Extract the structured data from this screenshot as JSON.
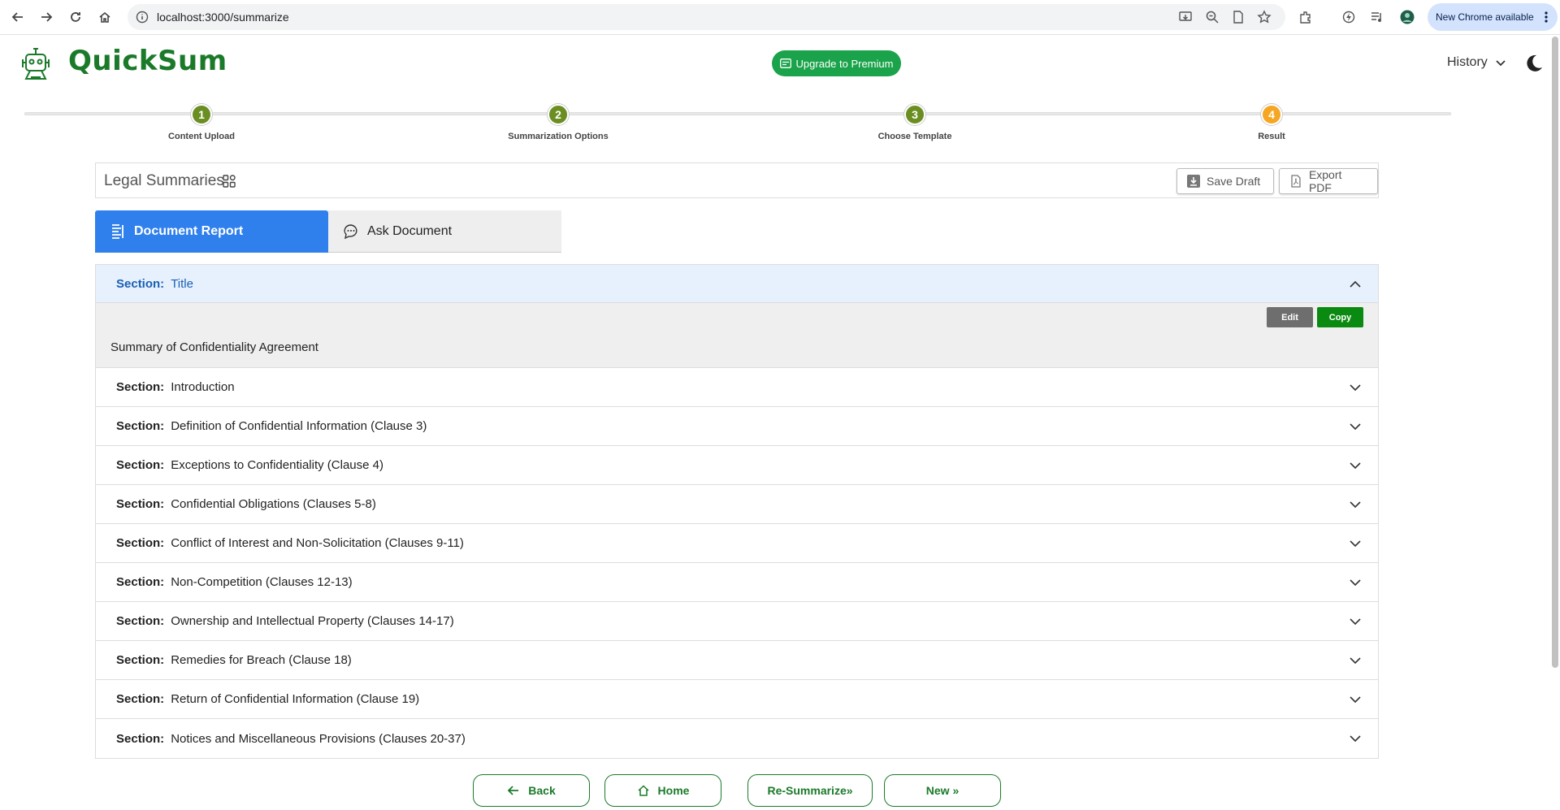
{
  "browser": {
    "url": "localhost:3000/summarize",
    "update_label": "New Chrome available"
  },
  "app": {
    "name": "QuickSum",
    "upgrade_label": "Upgrade to Premium",
    "history_label": "History",
    "brand_color": "#1b7a2a"
  },
  "stepper": {
    "steps": [
      {
        "number": "1",
        "label": "Content Upload",
        "color": "#6b8e23"
      },
      {
        "number": "2",
        "label": "Summarization Options",
        "color": "#6b8e23"
      },
      {
        "number": "3",
        "label": "Choose Template",
        "color": "#6b8e23"
      },
      {
        "number": "4",
        "label": "Result",
        "color": "#f5a623"
      }
    ]
  },
  "toolbar": {
    "title": "Legal Summaries",
    "save_draft_label": "Save Draft",
    "export_pdf_label": "Export PDF"
  },
  "tabs": {
    "active_label": "Document Report",
    "inactive_label": "Ask Document"
  },
  "sections": {
    "prefix": "Section:",
    "open": {
      "title": "Title",
      "content": "Summary of Confidentiality Agreement",
      "edit_label": "Edit",
      "copy_label": "Copy"
    },
    "collapsed": [
      "Introduction",
      "Definition of Confidential Information (Clause 3)",
      "Exceptions to Confidentiality (Clause 4)",
      "Confidential Obligations (Clauses 5-8)",
      "Conflict of Interest and Non-Solicitation (Clauses 9-11)",
      "Non-Competition (Clauses 12-13)",
      "Ownership and Intellectual Property (Clauses 14-17)",
      "Remedies for Breach (Clause 18)",
      "Return of Confidential Information (Clause 19)",
      "Notices and Miscellaneous Provisions (Clauses 20-37)"
    ]
  },
  "bottom": {
    "back_label": "Back",
    "home_label": "Home",
    "resummarize_label": "Re-Summarize»",
    "new_label": "New »"
  }
}
